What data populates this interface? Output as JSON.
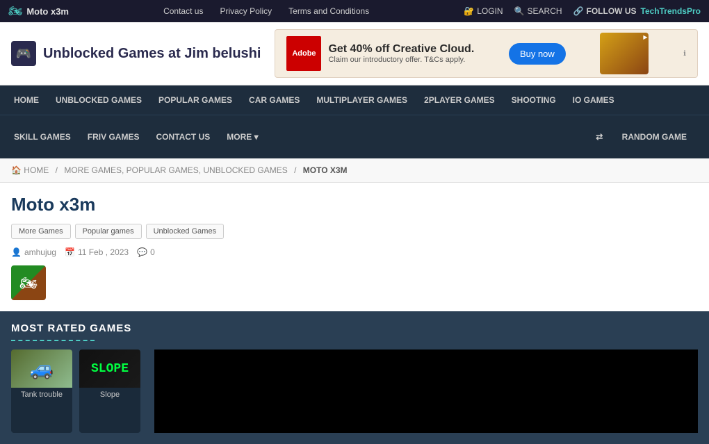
{
  "topbar": {
    "site_mini_title": "Moto x3m",
    "nav_links": [
      {
        "label": "Contact us",
        "href": "#"
      },
      {
        "label": "Privacy Policy",
        "href": "#"
      },
      {
        "label": "Terms and Conditions",
        "href": "#"
      }
    ],
    "login_label": "LOGIN",
    "search_label": "SEARCH",
    "follow_label": "FOLLOW US",
    "follow_brand": "TechTrendsPro"
  },
  "header": {
    "logo_icon": "♟",
    "site_name": "Unblocked Games at Jim belushi",
    "ad": {
      "adobe_label": "Adobe",
      "headline": "Get 40% off Creative Cloud.",
      "subtext": "Claim our introductory offer. T&Cs apply.",
      "buy_button": "Buy now"
    }
  },
  "nav_primary": {
    "items": [
      {
        "label": "HOME"
      },
      {
        "label": "UNBLOCKED GAMES"
      },
      {
        "label": "POPULAR GAMES"
      },
      {
        "label": "CAR GAMES"
      },
      {
        "label": "MULTIPLAYER GAMES"
      },
      {
        "label": "2PLAYER GAMES"
      },
      {
        "label": "SHOOTING"
      },
      {
        "label": "IO GAMES"
      }
    ]
  },
  "nav_secondary": {
    "items": [
      {
        "label": "SKILL GAMES"
      },
      {
        "label": "FRIV GAMES"
      },
      {
        "label": "CONTACT US"
      },
      {
        "label": "MORE ▾"
      }
    ],
    "random_label": "RANDOM GAME"
  },
  "breadcrumb": {
    "home": "HOME",
    "middle": "MORE GAMES, POPULAR GAMES, UNBLOCKED GAMES",
    "current": "MOTO X3M"
  },
  "page": {
    "title": "Moto x3m",
    "tags": [
      "More Games",
      "Popular games",
      "Unblocked Games"
    ],
    "author": "amhujug",
    "date": "11 Feb , 2023",
    "comments": "0"
  },
  "most_rated": {
    "heading": "MOST RATED GAMES",
    "games": [
      {
        "label": "Tank trouble",
        "type": "tank"
      },
      {
        "label": "Slope",
        "type": "slope"
      }
    ]
  }
}
